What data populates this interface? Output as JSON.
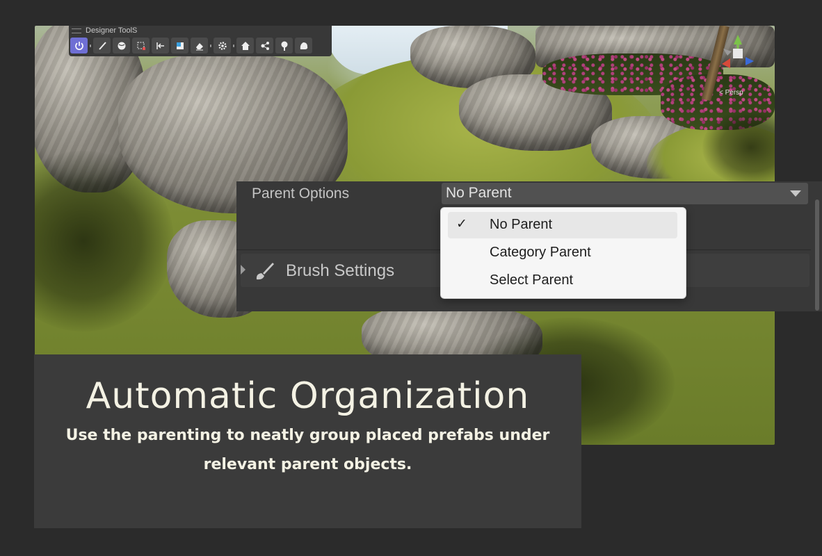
{
  "toolbar": {
    "title": "Designer ToolS",
    "tools": [
      {
        "icon": "power-icon",
        "active": true
      },
      {
        "icon": "brush-icon"
      },
      {
        "icon": "globe-icon"
      },
      {
        "icon": "dashed-select-icon"
      },
      {
        "icon": "align-left-icon"
      },
      {
        "icon": "square-icon"
      },
      {
        "icon": "eraser-icon"
      },
      {
        "icon": "gear-icon"
      },
      {
        "icon": "house-icon"
      },
      {
        "icon": "hierarchy-icon"
      },
      {
        "icon": "tree-icon"
      },
      {
        "icon": "rock-icon"
      }
    ]
  },
  "viewport": {
    "projection_label": "< Persp"
  },
  "inspector": {
    "parent_options_label": "Parent Options",
    "parent_options_value": "No Parent",
    "brush_settings_label": "Brush Settings"
  },
  "parent_menu": {
    "items": [
      {
        "label": "No Parent",
        "checked": true
      },
      {
        "label": "Category Parent",
        "checked": false
      },
      {
        "label": "Select Parent",
        "checked": false
      }
    ],
    "check_glyph": "✓"
  },
  "caption": {
    "headline": "Automatic Organization",
    "subline": "Use the parenting to neatly group placed prefabs under relevant parent objects."
  },
  "colors": {
    "background": "#2b2b2b",
    "panel": "#383838",
    "active_tool": "#6f6fd4",
    "caption_text": "#f4f2e4"
  }
}
